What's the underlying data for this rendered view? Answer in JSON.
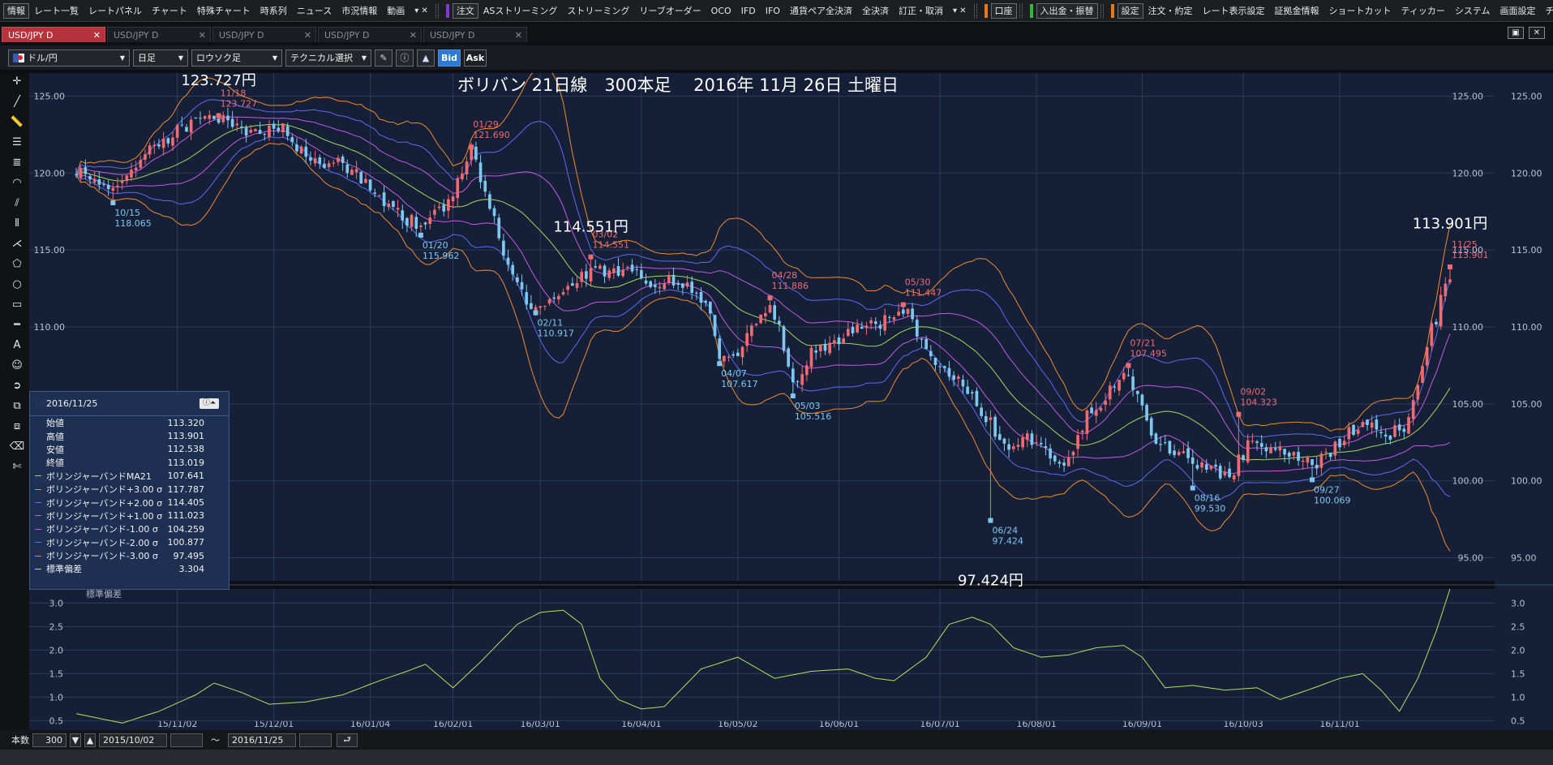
{
  "menubar": {
    "groups": [
      {
        "mark": "",
        "items": [
          "情報",
          "レート一覧",
          "レートパネル",
          "チャート",
          "特殊チャート",
          "時系列",
          "ニュース",
          "市況情報",
          "動画"
        ],
        "more": true
      },
      {
        "mark": "#7d3bd6",
        "items": [
          "注文",
          "ASストリーミング",
          "ストリーミング",
          "リーブオーダー",
          "OCO",
          "IFD",
          "IFO",
          "通貨ペア全決済",
          "全決済",
          "訂正・取消"
        ],
        "more": true
      },
      {
        "mark": "#e07a1a",
        "items": [
          "口座"
        ],
        "more": false
      },
      {
        "mark": "#2fb83d",
        "items": [
          "入出金・振替"
        ],
        "more": false
      },
      {
        "mark": "#e07a1a",
        "items": [
          "設定",
          "注文・約定",
          "レート表示設定",
          "証拠金情報",
          "ショートカット",
          "ティッカー",
          "システム",
          "画面設定",
          "チャート"
        ],
        "more": false
      }
    ]
  },
  "tabs": [
    {
      "label": "USD/JPY D",
      "active": true
    },
    {
      "label": "USD/JPY D",
      "active": false
    },
    {
      "label": "USD/JPY D",
      "active": false
    },
    {
      "label": "USD/JPY D",
      "active": false
    },
    {
      "label": "USD/JPY D",
      "active": false
    }
  ],
  "toolbar": {
    "pair": "ドル/円",
    "period": "日足",
    "chart_style": "ロウソク足",
    "technical": "テクニカル選択",
    "bid": "Bid",
    "ask": "Ask"
  },
  "chart_data": {
    "type": "candlestick",
    "title": "ボリバン 21日線　300本足　 2016年 11月 26日 土曜日",
    "y_ticks": [
      95,
      100,
      105,
      110,
      115,
      120,
      125
    ],
    "ylim": [
      93.5,
      126.5
    ],
    "x_ticks": [
      "15/11/02",
      "15/12/01",
      "16/01/04",
      "16/02/01",
      "16/03/01",
      "16/04/01",
      "16/05/02",
      "16/06/01",
      "16/07/01",
      "16/08/01",
      "16/09/01",
      "16/10/03",
      "16/11/01"
    ],
    "x_tick_index": [
      22,
      43,
      64,
      82,
      101,
      123,
      144,
      166,
      188,
      209,
      232,
      254,
      275
    ],
    "bar_count": 300,
    "close_keypoints": [
      [
        0,
        120.3
      ],
      [
        8,
        119.2
      ],
      [
        15,
        121.2
      ],
      [
        25,
        123.3
      ],
      [
        31,
        123.6
      ],
      [
        36,
        122.6
      ],
      [
        45,
        123.0
      ],
      [
        50,
        121.1
      ],
      [
        60,
        120.3
      ],
      [
        68,
        117.6
      ],
      [
        75,
        116.6
      ],
      [
        82,
        118.4
      ],
      [
        86,
        121.7
      ],
      [
        90,
        118.0
      ],
      [
        95,
        113.0
      ],
      [
        100,
        110.9
      ],
      [
        106,
        112.5
      ],
      [
        112,
        113.6
      ],
      [
        120,
        113.8
      ],
      [
        126,
        112.8
      ],
      [
        131,
        113.0
      ],
      [
        137,
        111.7
      ],
      [
        140,
        108.0
      ],
      [
        144,
        108.4
      ],
      [
        151,
        111.6
      ],
      [
        153,
        110.2
      ],
      [
        156,
        106.3
      ],
      [
        160,
        108.2
      ],
      [
        167,
        109.4
      ],
      [
        174,
        110.2
      ],
      [
        180,
        110.7
      ],
      [
        181,
        111.4
      ],
      [
        185,
        108.2
      ],
      [
        192,
        106.6
      ],
      [
        199,
        103.8
      ],
      [
        203,
        101.8
      ],
      [
        207,
        102.8
      ],
      [
        211,
        102.1
      ],
      [
        215,
        100.8
      ],
      [
        220,
        104.2
      ],
      [
        226,
        106.1
      ],
      [
        229,
        106.9
      ],
      [
        234,
        103.1
      ],
      [
        238,
        102.1
      ],
      [
        243,
        101.2
      ],
      [
        251,
        100.3
      ],
      [
        255,
        102.3
      ],
      [
        260,
        102.2
      ],
      [
        265,
        101.7
      ],
      [
        269,
        100.9
      ],
      [
        273,
        101.9
      ],
      [
        280,
        103.9
      ],
      [
        285,
        102.9
      ],
      [
        290,
        103.7
      ],
      [
        294,
        104.0
      ],
      [
        299,
        103.5
      ]
    ],
    "close_tail": [
      102.9,
      103.8,
      105.5,
      106.3,
      107.2,
      108.9,
      109.9,
      110.6,
      111.8,
      112.9,
      113.5
    ],
    "candle_seed": 5,
    "series": [
      {
        "name": "ボリンジャーバンドMA21",
        "value": "107.641",
        "color": "#9ed85a"
      },
      {
        "name": "ボリンジャーバンド+3.00 σ",
        "value": "117.787",
        "color": "#f08a2a"
      },
      {
        "name": "ボリンジャーバンド+2.00 σ",
        "value": "114.405",
        "color": "#5d6af0"
      },
      {
        "name": "ボリンジャーバンド+1.00 σ",
        "value": "111.023",
        "color": "#c35ae0"
      },
      {
        "name": "ボリンジャーバンド-1.00 σ",
        "value": "104.259",
        "color": "#c35ae0"
      },
      {
        "name": "ボリンジャーバンド-2.00 σ",
        "value": "100.877",
        "color": "#5d6af0"
      },
      {
        "name": "ボリンジャーバンド-3.00 σ",
        "value": "97.495",
        "color": "#f08a2a"
      }
    ],
    "up_color": "#f06a72",
    "down_color": "#7ec8ef",
    "background": "#152038",
    "annotations": [
      {
        "bar": 31,
        "date": "11/18",
        "price": "123.727",
        "kind": "high"
      },
      {
        "bar": 8,
        "date": "10/15",
        "price": "118.065",
        "kind": "low"
      },
      {
        "bar": 86,
        "date": "01/29",
        "price": "121.690",
        "kind": "high"
      },
      {
        "bar": 75,
        "date": "01/20",
        "price": "115.962",
        "kind": "low"
      },
      {
        "bar": 100,
        "date": "02/11",
        "price": "110.917",
        "kind": "low"
      },
      {
        "bar": 112,
        "date": "03/02",
        "price": "114.551",
        "kind": "high"
      },
      {
        "bar": 140,
        "date": "04/07",
        "price": "107.617",
        "kind": "low"
      },
      {
        "bar": 151,
        "date": "04/28",
        "price": "111.886",
        "kind": "high"
      },
      {
        "bar": 156,
        "date": "05/03",
        "price": "105.516",
        "kind": "low"
      },
      {
        "bar": 180,
        "date": "05/30",
        "price": "111.447",
        "kind": "high"
      },
      {
        "bar": 199,
        "date": "06/24",
        "price": "97.424",
        "kind": "low"
      },
      {
        "bar": 229,
        "date": "07/21",
        "price": "107.495",
        "kind": "high"
      },
      {
        "bar": 243,
        "date": "08/16",
        "price": "99.530",
        "kind": "low"
      },
      {
        "bar": 253,
        "date": "09/02",
        "price": "104.323",
        "kind": "high"
      },
      {
        "bar": 269,
        "date": "09/27",
        "price": "100.069",
        "kind": "low"
      },
      {
        "bar": 299,
        "date": "11/25",
        "price": "113.901",
        "kind": "high"
      }
    ],
    "big_labels": [
      {
        "text": "123.727円",
        "bar": 31,
        "value": 125.7
      },
      {
        "text": "114.551円",
        "bar": 112,
        "value": 116.2
      },
      {
        "text": "97.424円",
        "bar": 199,
        "value": 93.2
      },
      {
        "text": "113.901円",
        "bar": 299,
        "value": 116.4
      }
    ],
    "sub_panel": {
      "label": "標準偏差",
      "y_ticks": [
        0.5,
        1.0,
        1.5,
        2.0,
        2.5,
        3.0
      ],
      "ylim": [
        0.3,
        3.3
      ],
      "color": "#b4e05a",
      "keypoints": [
        [
          0,
          0.65
        ],
        [
          5,
          0.55
        ],
        [
          10,
          0.45
        ],
        [
          18,
          0.7
        ],
        [
          26,
          1.05
        ],
        [
          30,
          1.3
        ],
        [
          36,
          1.1
        ],
        [
          42,
          0.85
        ],
        [
          50,
          0.9
        ],
        [
          58,
          1.05
        ],
        [
          66,
          1.35
        ],
        [
          72,
          1.55
        ],
        [
          76,
          1.7
        ],
        [
          82,
          1.2
        ],
        [
          88,
          1.75
        ],
        [
          96,
          2.55
        ],
        [
          101,
          2.8
        ],
        [
          106,
          2.85
        ],
        [
          110,
          2.55
        ],
        [
          114,
          1.4
        ],
        [
          118,
          0.95
        ],
        [
          123,
          0.75
        ],
        [
          128,
          0.8
        ],
        [
          136,
          1.6
        ],
        [
          144,
          1.85
        ],
        [
          152,
          1.4
        ],
        [
          160,
          1.55
        ],
        [
          168,
          1.6
        ],
        [
          174,
          1.4
        ],
        [
          178,
          1.35
        ],
        [
          185,
          1.85
        ],
        [
          190,
          2.55
        ],
        [
          195,
          2.7
        ],
        [
          199,
          2.55
        ],
        [
          204,
          2.05
        ],
        [
          210,
          1.85
        ],
        [
          216,
          1.9
        ],
        [
          222,
          2.05
        ],
        [
          228,
          2.1
        ],
        [
          232,
          1.85
        ],
        [
          237,
          1.2
        ],
        [
          243,
          1.25
        ],
        [
          250,
          1.15
        ],
        [
          257,
          1.2
        ],
        [
          262,
          0.95
        ],
        [
          268,
          1.15
        ],
        [
          275,
          1.4
        ],
        [
          280,
          1.5
        ],
        [
          284,
          1.15
        ],
        [
          288,
          0.7
        ],
        [
          292,
          1.4
        ],
        [
          296,
          2.4
        ],
        [
          299,
          3.3
        ]
      ]
    }
  },
  "info_panel": {
    "date": "2016/11/25",
    "rows": [
      {
        "label": "始値",
        "value": "113.320"
      },
      {
        "label": "高値",
        "value": "113.901"
      },
      {
        "label": "安値",
        "value": "112.538"
      },
      {
        "label": "終値",
        "value": "113.019"
      }
    ],
    "stddev_label": "標準偏差",
    "stddev_value": "3.304"
  },
  "statusbar": {
    "bars_label": "本数",
    "bars_value": "300",
    "date_from": "2015/10/02",
    "tilde": "～",
    "date_to": "2016/11/25"
  }
}
